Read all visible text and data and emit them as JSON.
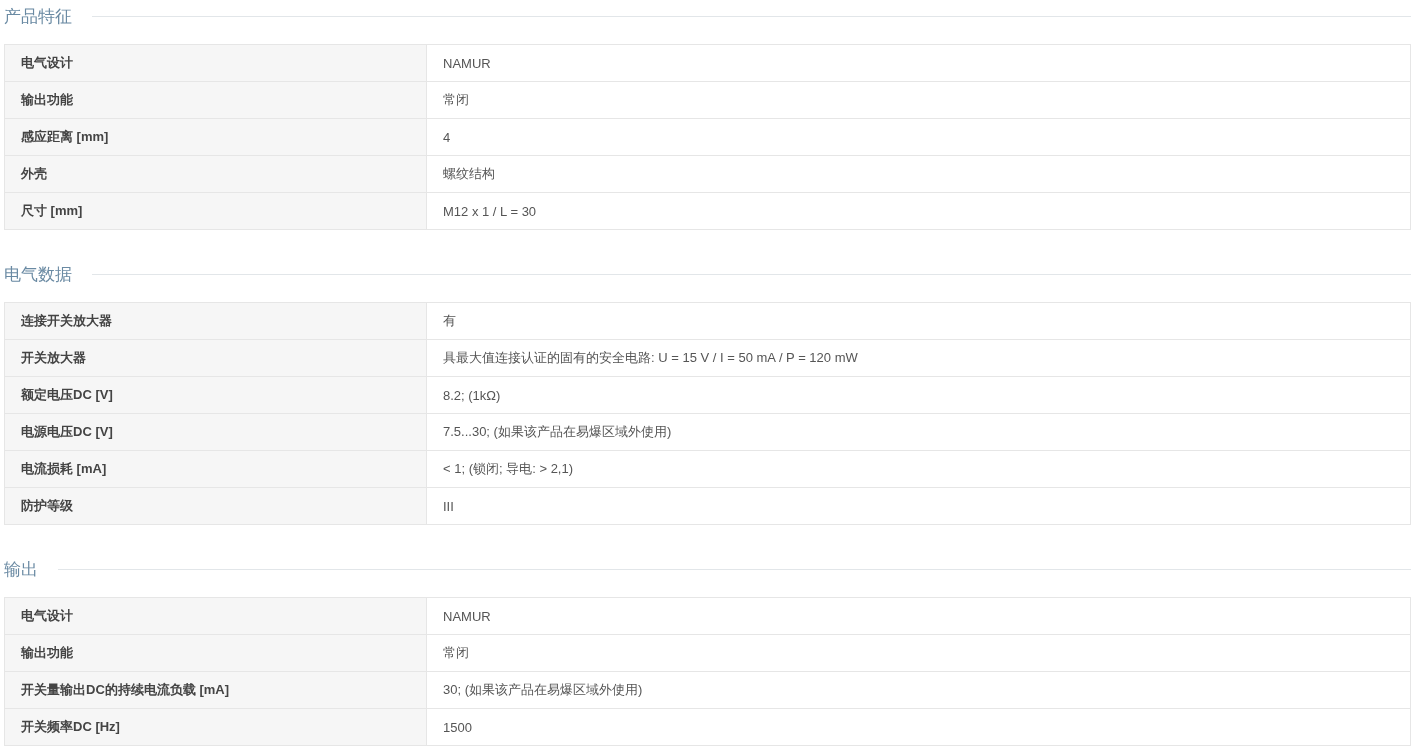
{
  "sections": [
    {
      "title": "产品特征",
      "rows": [
        {
          "label": "电气设计",
          "value": "NAMUR"
        },
        {
          "label": "输出功能",
          "value": "常闭"
        },
        {
          "label": "感应距离 [mm]",
          "value": "4"
        },
        {
          "label": "外壳",
          "value": "螺纹结构"
        },
        {
          "label": "尺寸 [mm]",
          "value": "M12 x 1 / L = 30"
        }
      ]
    },
    {
      "title": "电气数据",
      "rows": [
        {
          "label": "连接开关放大器",
          "value": "有"
        },
        {
          "label": "开关放大器",
          "value": "具最大值连接认证的固有的安全电路: U = 15 V / I = 50 mA / P = 120 mW"
        },
        {
          "label": "额定电压DC [V]",
          "value": "8.2; (1kΩ)"
        },
        {
          "label": "电源电压DC [V]",
          "value": "7.5...30; (如果该产品在易爆区域外使用)"
        },
        {
          "label": "电流损耗 [mA]",
          "value": "< 1; (锁闭; 导电: > 2,1)"
        },
        {
          "label": "防护等级",
          "value": "III"
        }
      ]
    },
    {
      "title": "输出",
      "rows": [
        {
          "label": "电气设计",
          "value": "NAMUR"
        },
        {
          "label": "输出功能",
          "value": "常闭"
        },
        {
          "label": "开关量输出DC的持续电流负载 [mA]",
          "value": "30; (如果该产品在易爆区域外使用)"
        },
        {
          "label": "开关频率DC [Hz]",
          "value": "1500"
        }
      ]
    }
  ]
}
